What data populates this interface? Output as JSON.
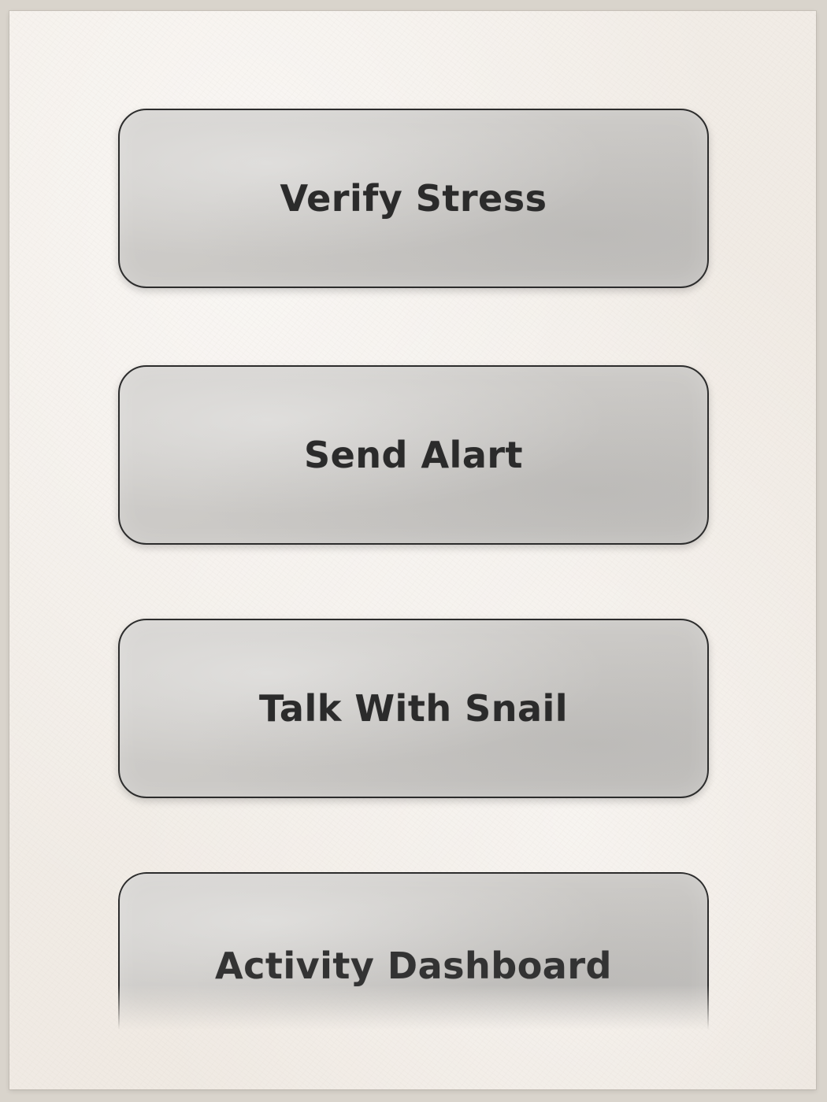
{
  "menu": {
    "items": [
      {
        "label": "Verify Stress"
      },
      {
        "label": "Send Alart"
      },
      {
        "label": "Talk With Snail"
      },
      {
        "label": "Activity Dashboard"
      }
    ]
  },
  "theme": {
    "paper_color": "#f1ece6",
    "button_fill": "#cbc9c6",
    "button_border": "#2c2c2c",
    "text_color": "#2b2b2b"
  }
}
